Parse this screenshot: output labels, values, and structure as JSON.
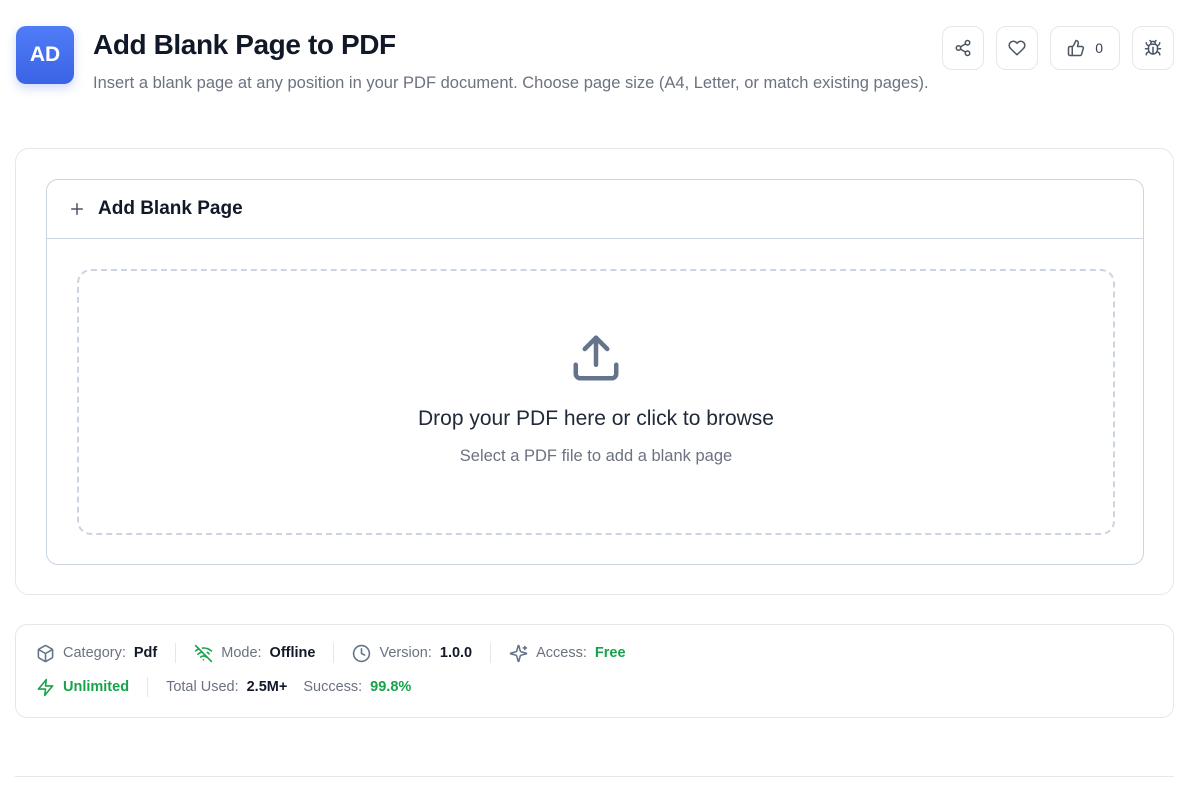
{
  "header": {
    "avatar_text": "AD",
    "title": "Add Blank Page to PDF",
    "description": "Insert a blank page at any position in your PDF document. Choose page size (A4, Letter, or match existing pages)."
  },
  "actions": {
    "share_icon": "share-icon",
    "favorite_icon": "heart-icon",
    "like_icon": "thumbs-up-icon",
    "like_count": "0",
    "report_icon": "bug-icon"
  },
  "tool": {
    "panel_title": "Add Blank Page",
    "dropzone_title": "Drop your PDF here or click to browse",
    "dropzone_subtitle": "Select a PDF file to add a blank page"
  },
  "info": {
    "category_label": "Category:",
    "category_value": "Pdf",
    "mode_label": "Mode:",
    "mode_value": "Offline",
    "version_label": "Version:",
    "version_value": "1.0.0",
    "access_label": "Access:",
    "access_value": "Free",
    "unlimited": "Unlimited",
    "total_used_label": "Total Used:",
    "total_used_value": "2.5M+",
    "success_label": "Success:",
    "success_value": "99.8%"
  },
  "colors": {
    "accent": "#3b63e6",
    "success": "#16a34a",
    "border": "#e5e7eb"
  }
}
